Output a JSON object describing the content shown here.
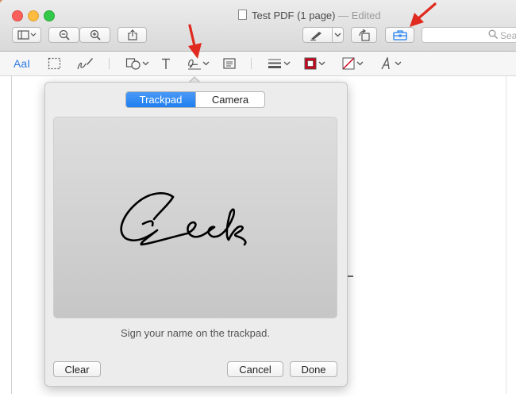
{
  "window": {
    "title": "Test PDF (1 page)",
    "title_separator": "—",
    "title_status": "Edited"
  },
  "toolbar": {
    "search_placeholder": "Sea",
    "icons": [
      "sidebar-icon",
      "zoom-out-icon",
      "zoom-in-icon",
      "share-icon",
      "pen-icon",
      "rotate-icon",
      "toolbox-icon",
      "search-icon"
    ]
  },
  "markup_toolbar": {
    "text_style_label": "AaI",
    "icons": [
      "text-style-icon",
      "rect-select-icon",
      "sketch-icon",
      "shapes-icon",
      "text-icon",
      "signature-icon",
      "note-icon",
      "line-style-icon",
      "border-color-icon",
      "fill-color-icon",
      "font-icon"
    ]
  },
  "signature_popover": {
    "tabs": [
      {
        "label": "Trackpad",
        "selected": true
      },
      {
        "label": "Camera",
        "selected": false
      }
    ],
    "instruction": "Sign your name on the trackpad.",
    "signature_text": "Geek",
    "buttons": {
      "clear": "Clear",
      "cancel": "Cancel",
      "done": "Done"
    }
  },
  "colors": {
    "accent": "#1f7ef0",
    "annotation_arrow": "#e02a1f",
    "border_color_swatch": "#d0021b"
  }
}
